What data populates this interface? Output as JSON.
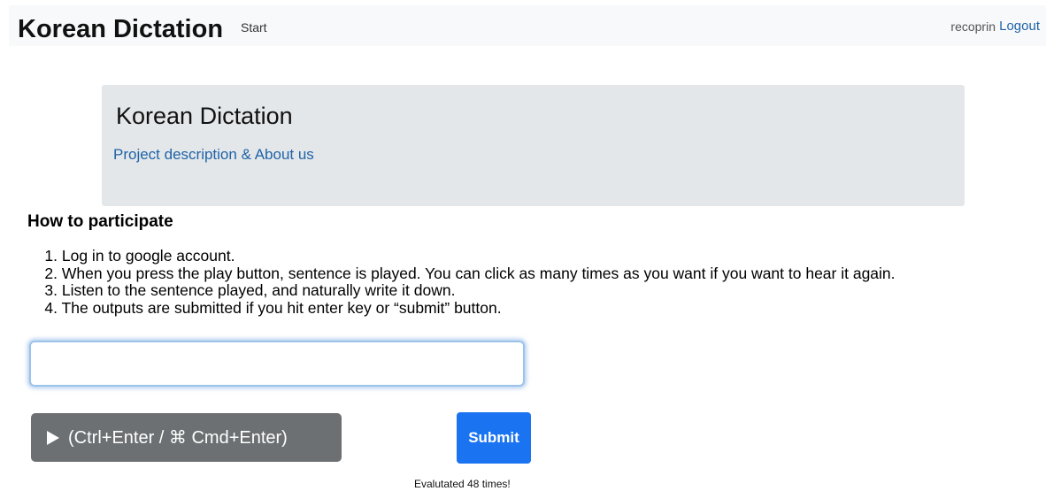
{
  "navbar": {
    "brand": "Korean Dictation",
    "start_link": "Start",
    "username": "recoprin",
    "logout_link": "Logout"
  },
  "jumbotron": {
    "title": "Korean Dictation",
    "link": "Project description & About us"
  },
  "instructions": {
    "title": "How to participate",
    "steps": [
      {
        "num": "1.",
        "text": "Log in to google account."
      },
      {
        "num": "2.",
        "text": "When you press the play button, sentence is played. You can click as many times as you want if you want to hear it again."
      },
      {
        "num": "3.",
        "text": "Listen to the sentence played, and naturally write it down."
      },
      {
        "num": "4.",
        "text": "The outputs are submitted if you hit enter key or “submit” button."
      }
    ]
  },
  "answer_input": {
    "value": "",
    "placeholder": ""
  },
  "play_button": {
    "icon": "play-icon",
    "label": "(Ctrl+Enter / ⌘ Cmd+Enter)"
  },
  "submit_button": {
    "label": "Submit"
  },
  "status": {
    "evaluated_text": "Evalutated 48 times!"
  },
  "colors": {
    "link": "#1f63a6",
    "play_button_bg": "#6c7073",
    "submit_button_bg": "#1a73f0",
    "jumbotron_bg": "#e4e7ea",
    "navbar_bg": "#f8f9fa"
  }
}
